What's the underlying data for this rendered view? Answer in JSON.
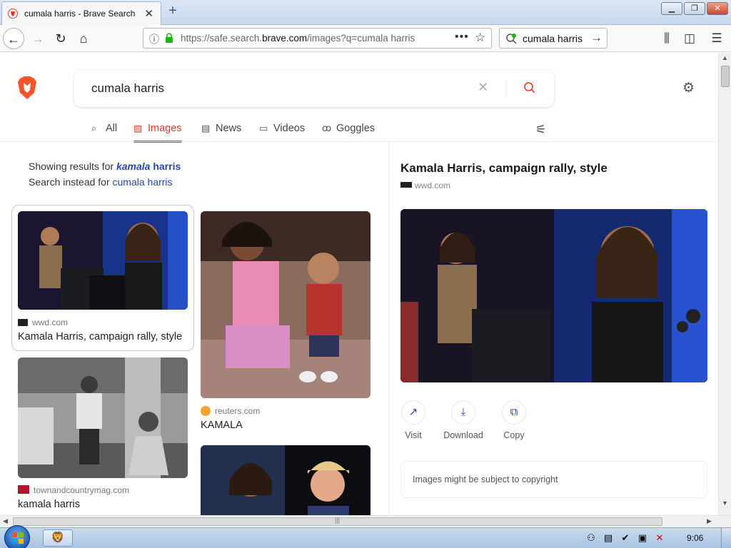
{
  "browser": {
    "tab_title": "cumala harris - Brave Search",
    "url_prefix": "https://safe.search.",
    "url_domain": "brave.com",
    "url_path": "/images?q=cumala harris",
    "search_box_value": "cumala harris"
  },
  "search": {
    "query": "cumala harris",
    "tabs": [
      "All",
      "Images",
      "News",
      "Videos",
      "Goggles"
    ],
    "active_tab": "Images"
  },
  "correction": {
    "showing_prefix": "Showing results for",
    "corrected_first": "kamala",
    "corrected_second": "harris",
    "instead_prefix": "Search instead for",
    "original_query": "cumala harris"
  },
  "results": [
    {
      "source": "wwd.com",
      "caption": "Kamala Harris, campaign rally, style"
    },
    {
      "source": "townandcountrymag.com",
      "caption": "kamala harris"
    },
    {
      "source": "reuters.com",
      "caption": "KAMALA"
    }
  ],
  "panel": {
    "title": "Kamala Harris, campaign rally, style",
    "source": "wwd.com",
    "actions": [
      "Visit",
      "Download",
      "Copy"
    ],
    "copyright_notice": "Images might be subject to copyright"
  },
  "taskbar": {
    "clock": "9:06"
  },
  "colors": {
    "accent": "#e2382a",
    "link": "#2945a8"
  }
}
